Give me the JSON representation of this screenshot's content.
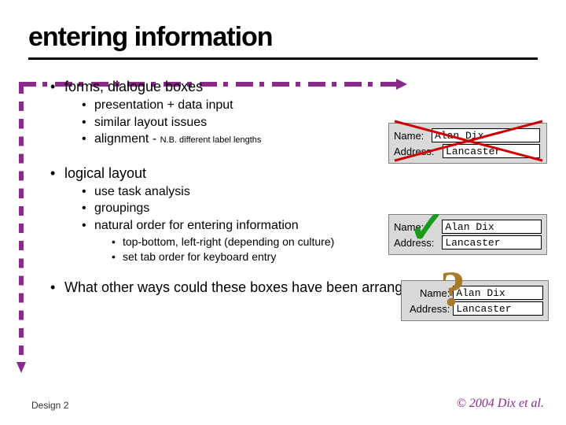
{
  "title": "entering information",
  "bullets": {
    "b1": "forms, dialogue boxes",
    "b1a": "presentation + data input",
    "b1b": "similar layout issues",
    "b1c_prefix": "alignment - ",
    "b1c_note": "N.B. different label lengths",
    "b2": "logical layout",
    "b2a": "use task analysis",
    "b2b": "groupings",
    "b2c": "natural order for entering information",
    "b2c1": "top-bottom, left-right (depending on culture)",
    "b2c2": "set tab order for keyboard entry",
    "b3": "What other ways could these boxes have been arranged?"
  },
  "form": {
    "name_label": "Name:",
    "address_label": "Address:",
    "name_value": "Alan Dix",
    "address_value": "Lancaster"
  },
  "footer": {
    "left": "Design 2",
    "right": "© 2004 Dix et al."
  }
}
